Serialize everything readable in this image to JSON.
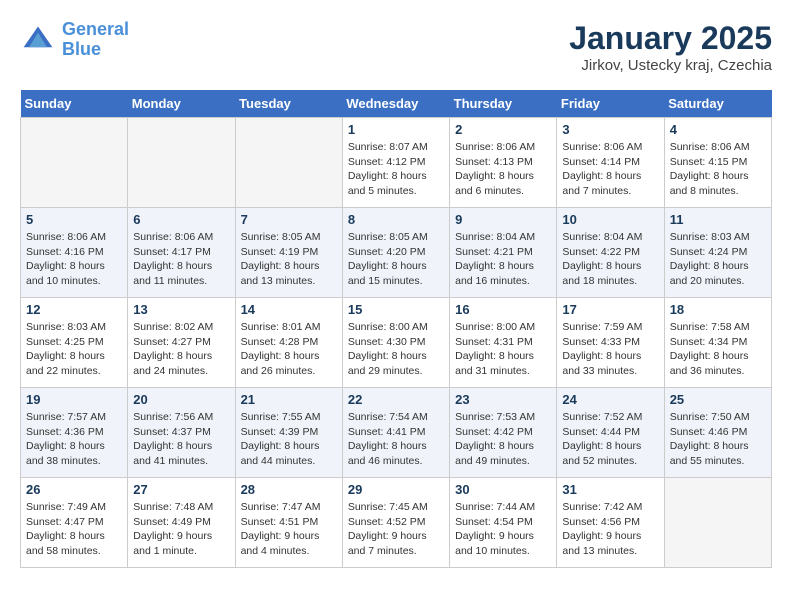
{
  "header": {
    "logo_line1": "General",
    "logo_line2": "Blue",
    "month": "January 2025",
    "location": "Jirkov, Ustecky kraj, Czechia"
  },
  "weekdays": [
    "Sunday",
    "Monday",
    "Tuesday",
    "Wednesday",
    "Thursday",
    "Friday",
    "Saturday"
  ],
  "weeks": [
    [
      {
        "day": "",
        "info": ""
      },
      {
        "day": "",
        "info": ""
      },
      {
        "day": "",
        "info": ""
      },
      {
        "day": "1",
        "info": "Sunrise: 8:07 AM\nSunset: 4:12 PM\nDaylight: 8 hours\nand 5 minutes."
      },
      {
        "day": "2",
        "info": "Sunrise: 8:06 AM\nSunset: 4:13 PM\nDaylight: 8 hours\nand 6 minutes."
      },
      {
        "day": "3",
        "info": "Sunrise: 8:06 AM\nSunset: 4:14 PM\nDaylight: 8 hours\nand 7 minutes."
      },
      {
        "day": "4",
        "info": "Sunrise: 8:06 AM\nSunset: 4:15 PM\nDaylight: 8 hours\nand 8 minutes."
      }
    ],
    [
      {
        "day": "5",
        "info": "Sunrise: 8:06 AM\nSunset: 4:16 PM\nDaylight: 8 hours\nand 10 minutes."
      },
      {
        "day": "6",
        "info": "Sunrise: 8:06 AM\nSunset: 4:17 PM\nDaylight: 8 hours\nand 11 minutes."
      },
      {
        "day": "7",
        "info": "Sunrise: 8:05 AM\nSunset: 4:19 PM\nDaylight: 8 hours\nand 13 minutes."
      },
      {
        "day": "8",
        "info": "Sunrise: 8:05 AM\nSunset: 4:20 PM\nDaylight: 8 hours\nand 15 minutes."
      },
      {
        "day": "9",
        "info": "Sunrise: 8:04 AM\nSunset: 4:21 PM\nDaylight: 8 hours\nand 16 minutes."
      },
      {
        "day": "10",
        "info": "Sunrise: 8:04 AM\nSunset: 4:22 PM\nDaylight: 8 hours\nand 18 minutes."
      },
      {
        "day": "11",
        "info": "Sunrise: 8:03 AM\nSunset: 4:24 PM\nDaylight: 8 hours\nand 20 minutes."
      }
    ],
    [
      {
        "day": "12",
        "info": "Sunrise: 8:03 AM\nSunset: 4:25 PM\nDaylight: 8 hours\nand 22 minutes."
      },
      {
        "day": "13",
        "info": "Sunrise: 8:02 AM\nSunset: 4:27 PM\nDaylight: 8 hours\nand 24 minutes."
      },
      {
        "day": "14",
        "info": "Sunrise: 8:01 AM\nSunset: 4:28 PM\nDaylight: 8 hours\nand 26 minutes."
      },
      {
        "day": "15",
        "info": "Sunrise: 8:00 AM\nSunset: 4:30 PM\nDaylight: 8 hours\nand 29 minutes."
      },
      {
        "day": "16",
        "info": "Sunrise: 8:00 AM\nSunset: 4:31 PM\nDaylight: 8 hours\nand 31 minutes."
      },
      {
        "day": "17",
        "info": "Sunrise: 7:59 AM\nSunset: 4:33 PM\nDaylight: 8 hours\nand 33 minutes."
      },
      {
        "day": "18",
        "info": "Sunrise: 7:58 AM\nSunset: 4:34 PM\nDaylight: 8 hours\nand 36 minutes."
      }
    ],
    [
      {
        "day": "19",
        "info": "Sunrise: 7:57 AM\nSunset: 4:36 PM\nDaylight: 8 hours\nand 38 minutes."
      },
      {
        "day": "20",
        "info": "Sunrise: 7:56 AM\nSunset: 4:37 PM\nDaylight: 8 hours\nand 41 minutes."
      },
      {
        "day": "21",
        "info": "Sunrise: 7:55 AM\nSunset: 4:39 PM\nDaylight: 8 hours\nand 44 minutes."
      },
      {
        "day": "22",
        "info": "Sunrise: 7:54 AM\nSunset: 4:41 PM\nDaylight: 8 hours\nand 46 minutes."
      },
      {
        "day": "23",
        "info": "Sunrise: 7:53 AM\nSunset: 4:42 PM\nDaylight: 8 hours\nand 49 minutes."
      },
      {
        "day": "24",
        "info": "Sunrise: 7:52 AM\nSunset: 4:44 PM\nDaylight: 8 hours\nand 52 minutes."
      },
      {
        "day": "25",
        "info": "Sunrise: 7:50 AM\nSunset: 4:46 PM\nDaylight: 8 hours\nand 55 minutes."
      }
    ],
    [
      {
        "day": "26",
        "info": "Sunrise: 7:49 AM\nSunset: 4:47 PM\nDaylight: 8 hours\nand 58 minutes."
      },
      {
        "day": "27",
        "info": "Sunrise: 7:48 AM\nSunset: 4:49 PM\nDaylight: 9 hours\nand 1 minute."
      },
      {
        "day": "28",
        "info": "Sunrise: 7:47 AM\nSunset: 4:51 PM\nDaylight: 9 hours\nand 4 minutes."
      },
      {
        "day": "29",
        "info": "Sunrise: 7:45 AM\nSunset: 4:52 PM\nDaylight: 9 hours\nand 7 minutes."
      },
      {
        "day": "30",
        "info": "Sunrise: 7:44 AM\nSunset: 4:54 PM\nDaylight: 9 hours\nand 10 minutes."
      },
      {
        "day": "31",
        "info": "Sunrise: 7:42 AM\nSunset: 4:56 PM\nDaylight: 9 hours\nand 13 minutes."
      },
      {
        "day": "",
        "info": ""
      }
    ]
  ]
}
